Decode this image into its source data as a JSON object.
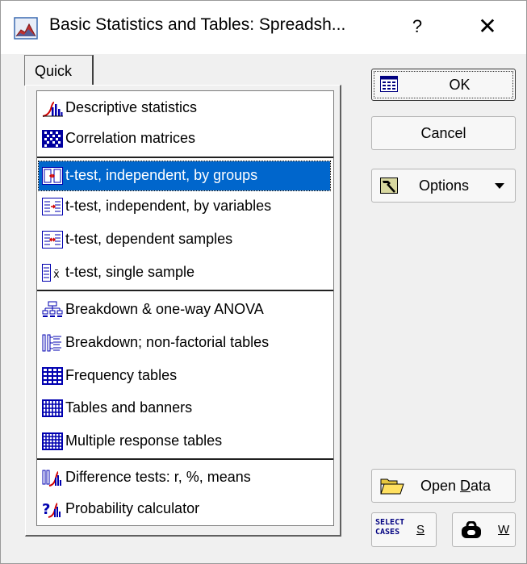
{
  "window": {
    "title": "Basic Statistics and Tables: Spreadsh...",
    "help": "?",
    "close": "✕"
  },
  "tab": {
    "label": "Quick"
  },
  "list": {
    "items": [
      {
        "label": "Descriptive statistics",
        "icon": "descriptive-statistics-icon"
      },
      {
        "label": "Correlation matrices",
        "icon": "correlation-matrix-icon"
      },
      {
        "label": "t-test, independent, by groups",
        "icon": "t-test-groups-icon",
        "selected": true
      },
      {
        "label": "t-test, independent, by variables",
        "icon": "t-test-variables-icon"
      },
      {
        "label": "t-test, dependent samples",
        "icon": "t-test-dependent-icon"
      },
      {
        "label": "t-test, single sample",
        "icon": "t-test-single-icon",
        "glyph": "x̄"
      },
      {
        "label": "Breakdown & one-way ANOVA",
        "icon": "breakdown-anova-icon"
      },
      {
        "label": "Breakdown; non-factorial tables",
        "icon": "breakdown-nonfactorial-icon"
      },
      {
        "label": "Frequency tables",
        "icon": "frequency-table-icon"
      },
      {
        "label": "Tables and banners",
        "icon": "tables-banners-icon"
      },
      {
        "label": "Multiple response tables",
        "icon": "multiple-response-icon"
      },
      {
        "label": "Difference tests: r, %, means",
        "icon": "difference-tests-icon"
      },
      {
        "label": "Probability calculator",
        "icon": "probability-calculator-icon",
        "glyph": "?"
      }
    ]
  },
  "buttons": {
    "ok": "OK",
    "cancel": "Cancel",
    "options": "Options",
    "open_data_prefix": "Open ",
    "open_data_mnemonic": "D",
    "open_data_suffix": "ata",
    "select_cases_line1": "SELECT",
    "select_cases_line2": "CASES",
    "select_cases_key": "S",
    "weight_key": "W"
  },
  "colors": {
    "selection": "#0066cc",
    "dialog_bg": "#f0f0f0",
    "icon_blue": "#0000b0",
    "icon_red": "#d00000"
  }
}
